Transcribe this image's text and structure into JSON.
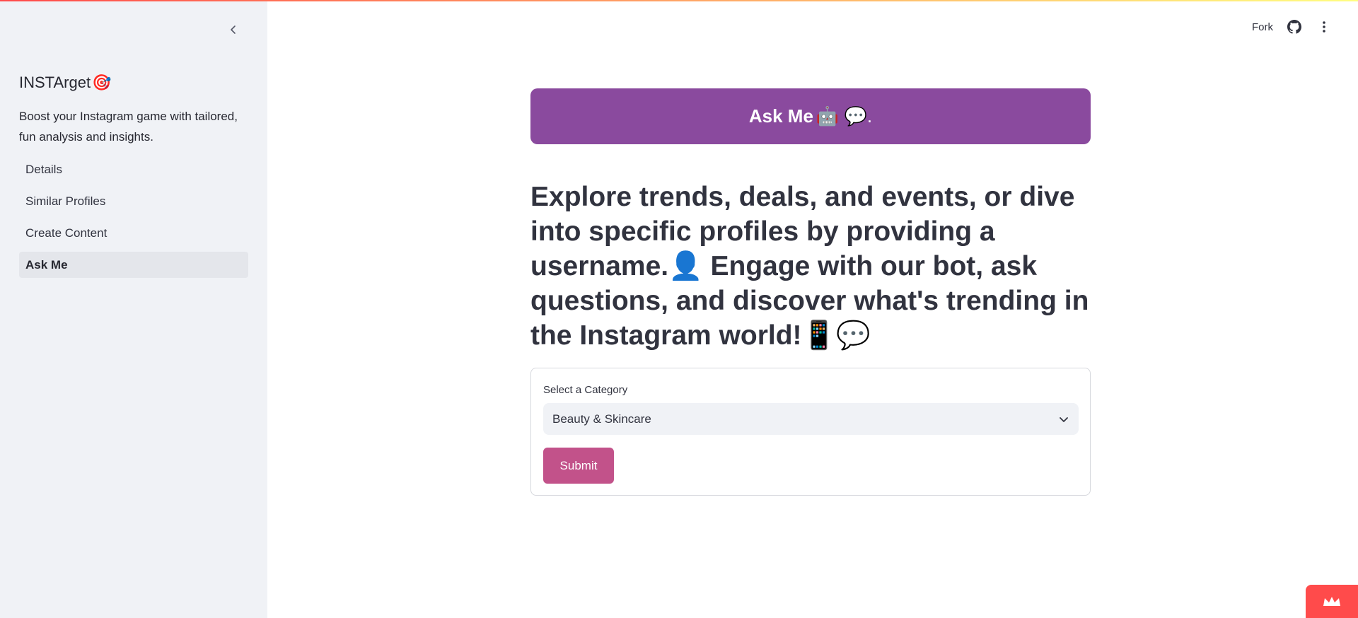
{
  "app": {
    "title": "INSTArget",
    "title_emoji": "🎯",
    "description": "Boost your Instagram game with tailored, fun analysis and insights."
  },
  "sidebar": {
    "collapse_icon": "chevron-left-icon",
    "items": [
      {
        "label": "Details",
        "active": false
      },
      {
        "label": "Similar Profiles",
        "active": false
      },
      {
        "label": "Create Content",
        "active": false
      },
      {
        "label": "Ask Me",
        "active": true
      }
    ]
  },
  "header": {
    "fork_label": "Fork",
    "github_icon": "github-icon",
    "menu_icon": "more-vertical-icon"
  },
  "banner": {
    "text": "Ask Me",
    "emoji": "🤖 💬."
  },
  "hero": {
    "text": "Explore trends, deals, and events, or dive into specific profiles by providing a username.👤 Engage with our bot, ask questions, and discover what's trending in the Instagram world!📱💬"
  },
  "form": {
    "category_label": "Select a Category",
    "category_value": "Beauty & Skincare",
    "submit_label": "Submit"
  },
  "colors": {
    "banner": "#8a4a9e",
    "submit": "#c2528a",
    "sidebar_bg": "#f0f2f6",
    "accent": "#ff4b4b"
  }
}
